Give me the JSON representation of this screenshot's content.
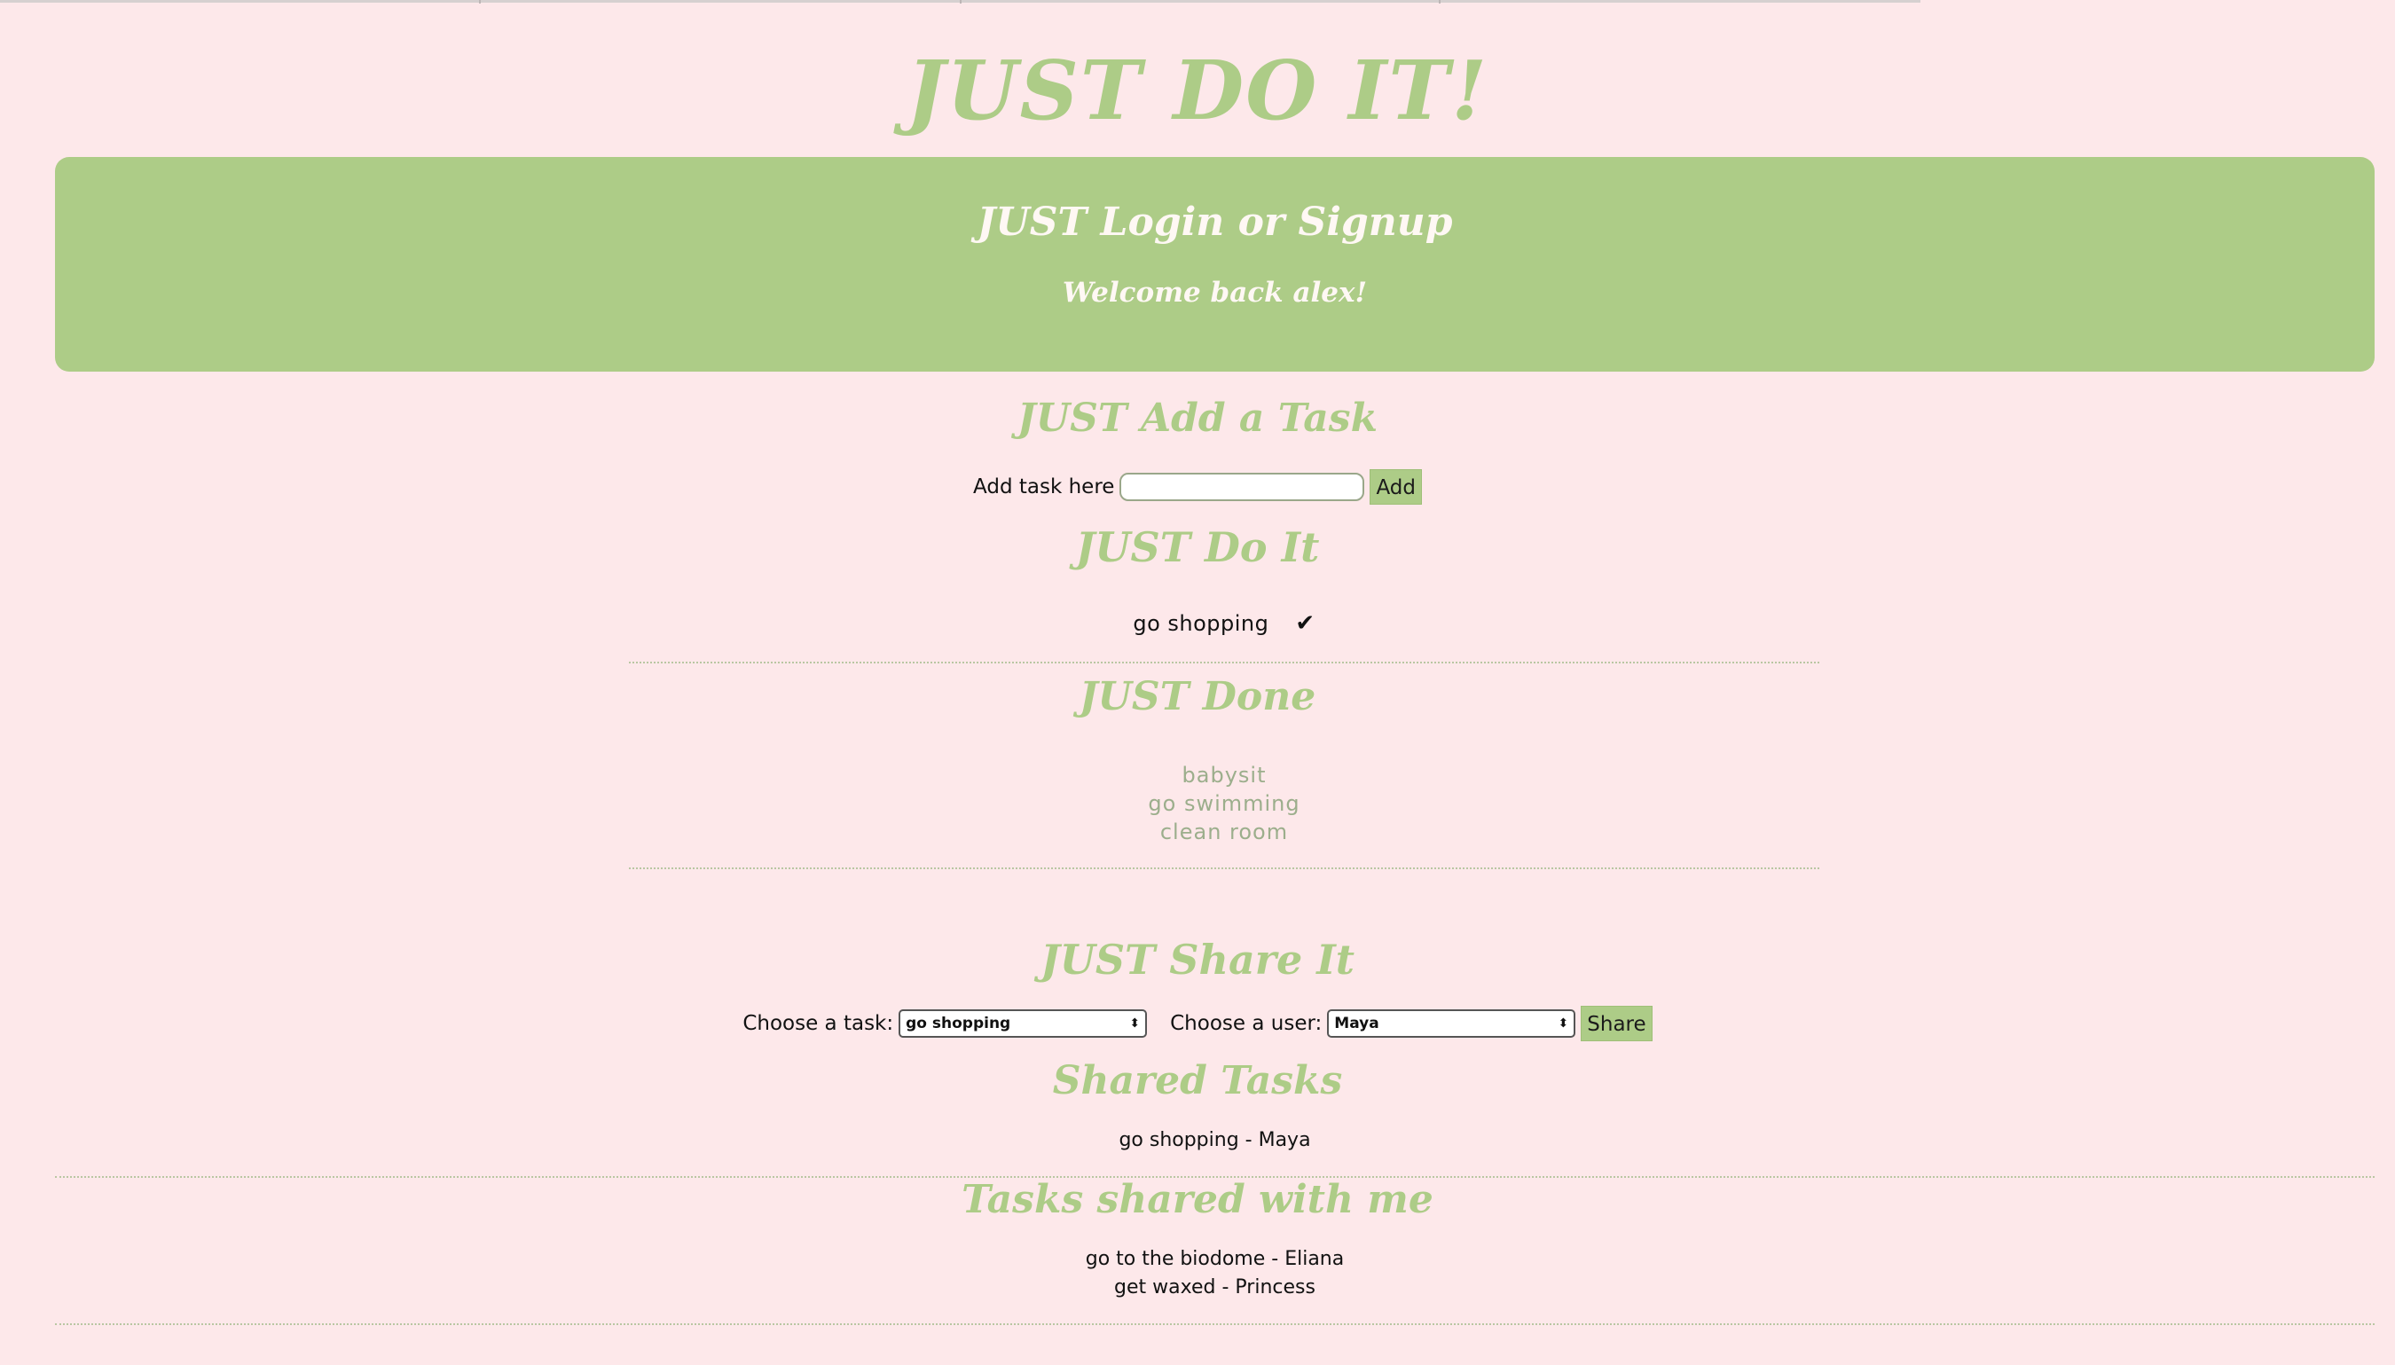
{
  "page": {
    "title": "JUST DO IT!",
    "accent_color": "#adcc87",
    "background_color": "#fde8ea"
  },
  "banner": {
    "heading": "JUST Login or Signup",
    "welcome": "Welcome back alex!"
  },
  "add_section": {
    "heading": "JUST Add a Task",
    "label": "Add task here",
    "input_value": "",
    "button_label": "Add"
  },
  "todo_section": {
    "heading": "JUST Do It",
    "items": [
      {
        "text": "go shopping",
        "check_icon": "✔"
      }
    ]
  },
  "done_section": {
    "heading": "JUST Done",
    "items": [
      "babysit",
      "go swimming",
      "clean room"
    ]
  },
  "share_section": {
    "heading": "JUST Share It",
    "task_label": "Choose a task:",
    "task_selected": "go shopping",
    "user_label": "Choose a user:",
    "user_selected": "Maya",
    "button_label": "Share"
  },
  "shared_tasks": {
    "heading": "Shared Tasks",
    "items": [
      "go shopping - Maya"
    ]
  },
  "shared_with_me": {
    "heading": "Tasks shared with me",
    "items": [
      "go to the biodome - Eliana",
      "get waxed - Princess"
    ]
  }
}
